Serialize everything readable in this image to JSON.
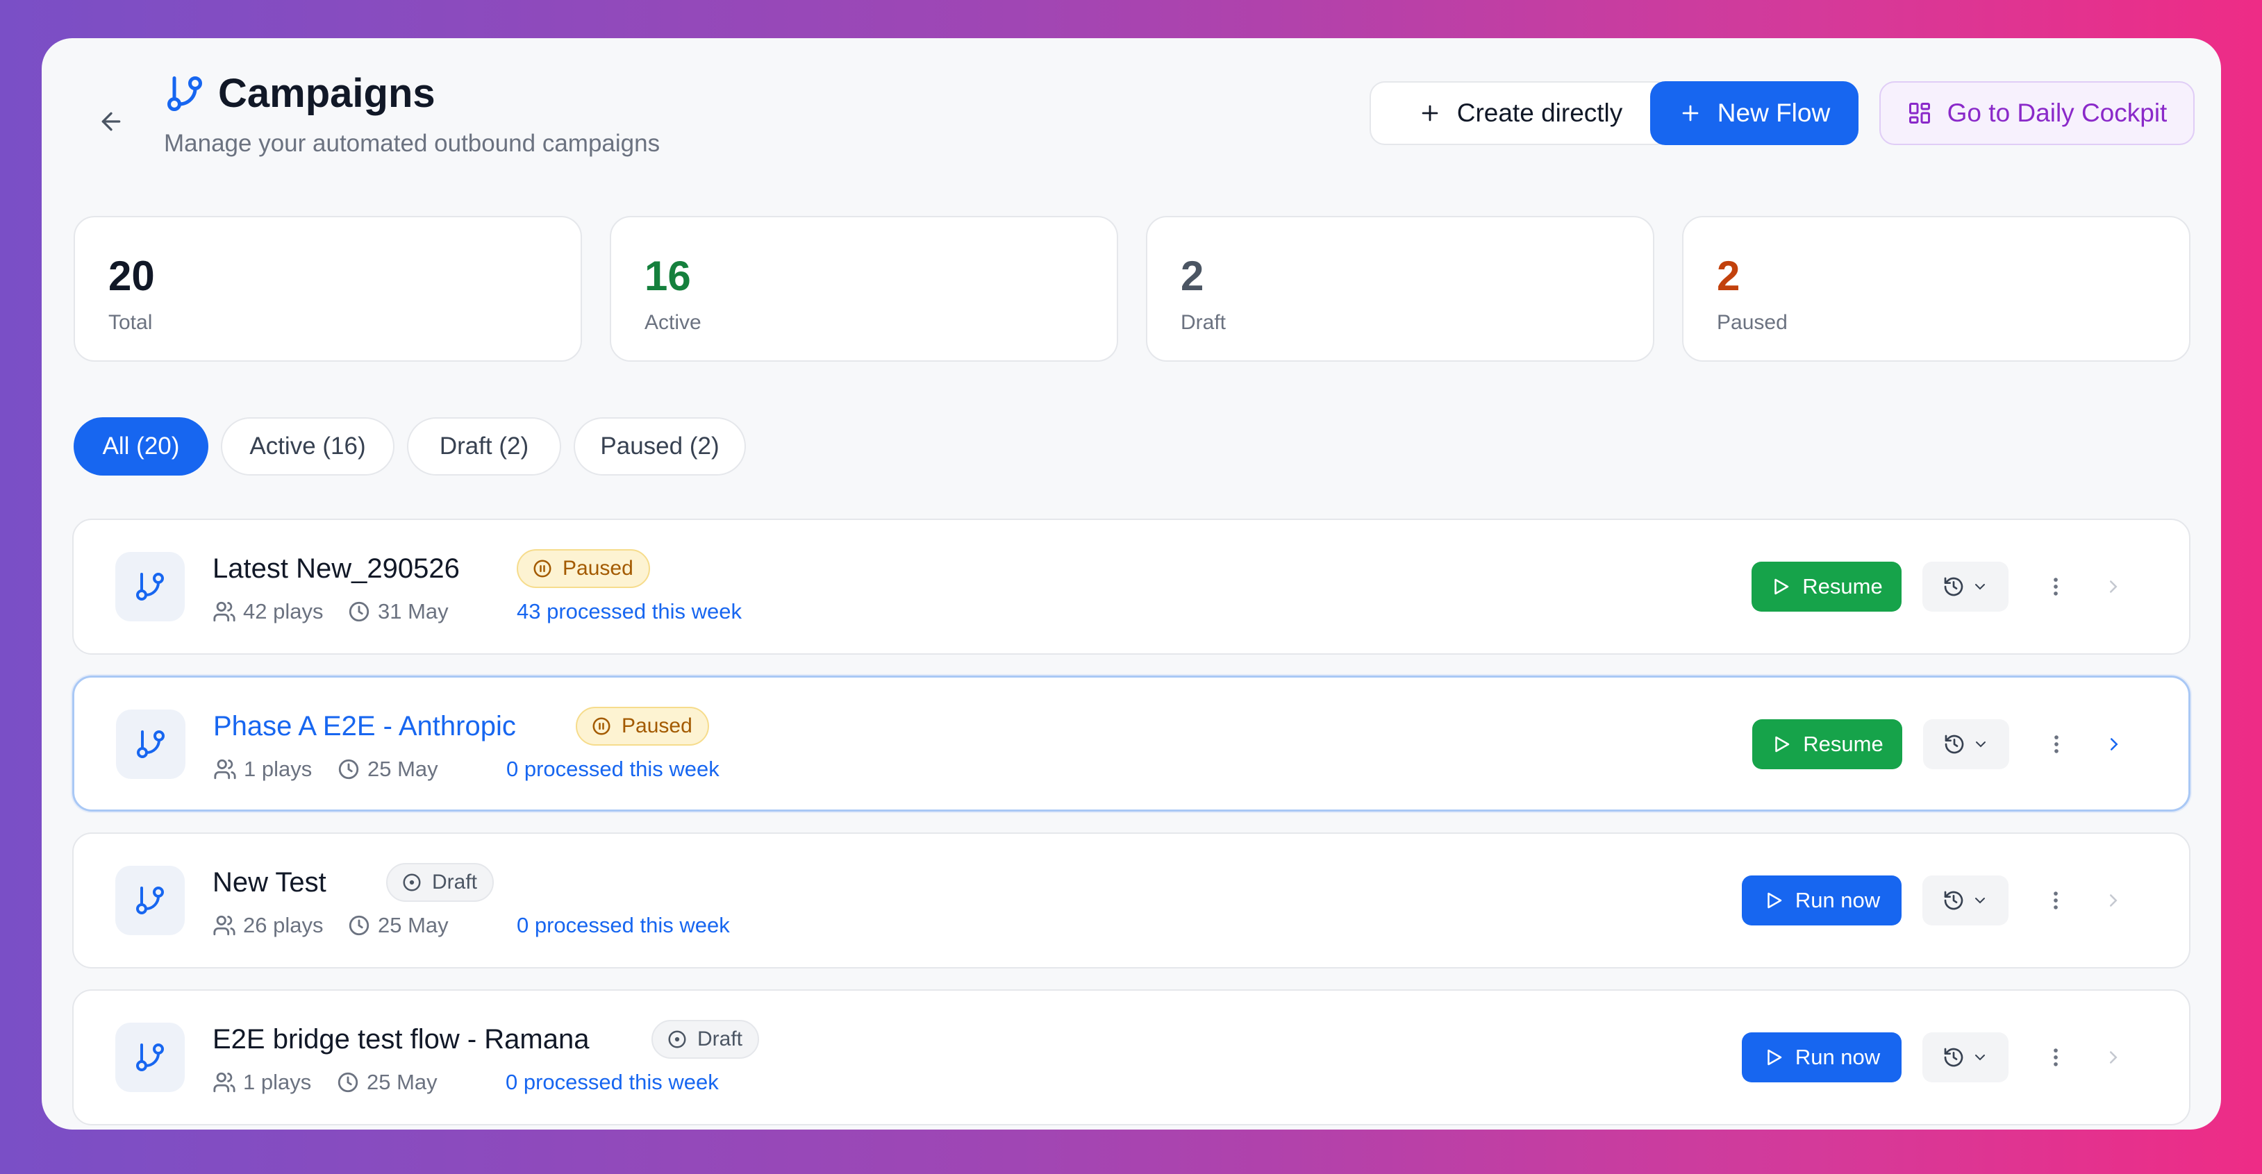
{
  "header": {
    "title": "Campaigns",
    "subtitle": "Manage your automated outbound campaigns",
    "back_icon": "arrow-left-icon",
    "title_icon": "git-branch-icon"
  },
  "actions": {
    "create_directly": "Create directly",
    "new_flow": "New Flow",
    "daily_cockpit": "Go to Daily Cockpit"
  },
  "stats": [
    {
      "value": "20",
      "label": "Total",
      "color": "#111827"
    },
    {
      "value": "16",
      "label": "Active",
      "color": "#15803d"
    },
    {
      "value": "2",
      "label": "Draft",
      "color": "#4b5563"
    },
    {
      "value": "2",
      "label": "Paused",
      "color": "#c2410c"
    }
  ],
  "tabs": [
    {
      "label": "All (20)",
      "active": true
    },
    {
      "label": "Active (16)",
      "active": false
    },
    {
      "label": "Draft (2)",
      "active": false
    },
    {
      "label": "Paused (2)",
      "active": false
    }
  ],
  "campaigns": [
    {
      "name": "Latest New_290526",
      "status": "Paused",
      "plays": "42 plays",
      "date": "31 May",
      "processed": "43 processed this week",
      "action": "Resume"
    },
    {
      "name": "Phase A E2E - Anthropic",
      "status": "Paused",
      "plays": "1 plays",
      "date": "25 May",
      "processed": "0 processed this week",
      "action": "Resume"
    },
    {
      "name": "New Test",
      "status": "Draft",
      "plays": "26 plays",
      "date": "25 May",
      "processed": "0 processed this week",
      "action": "Run now"
    },
    {
      "name": "E2E bridge test flow - Ramana",
      "status": "Draft",
      "plays": "1 plays",
      "date": "25 May",
      "processed": "0 processed this week",
      "action": "Run now"
    }
  ],
  "colors": {
    "primary": "#1766f0",
    "success": "#16a34a",
    "purple": "#8a29c9",
    "paused_badge": "#fdf3d2",
    "draft_badge": "#f3f4f6"
  }
}
